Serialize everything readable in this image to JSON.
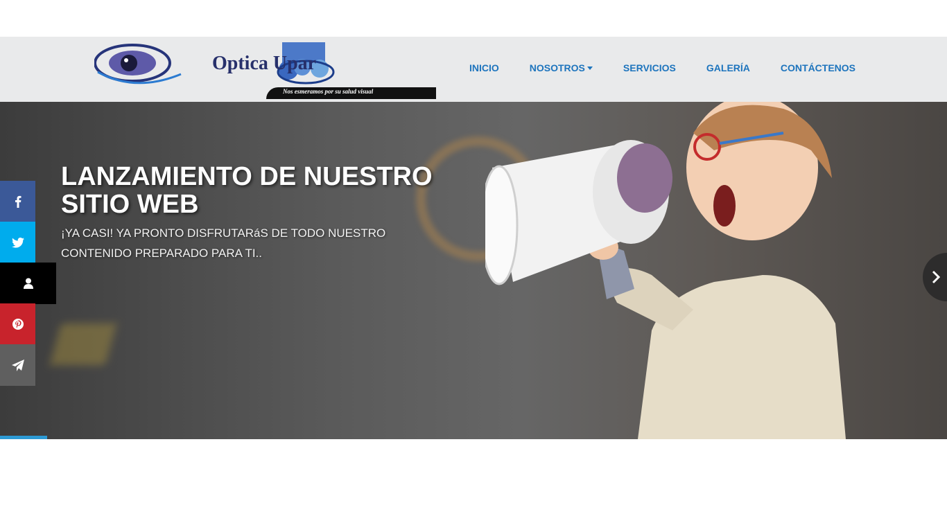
{
  "brand": {
    "name": "Optica Upar",
    "tagline": "Nos esmeramos por su salud visual"
  },
  "nav": {
    "items": [
      {
        "label": "INICIO"
      },
      {
        "label": "NOSOTROS"
      },
      {
        "label": "SERVICIOS"
      },
      {
        "label": "GALERÍA"
      },
      {
        "label": "CONTÁCTENOS"
      }
    ]
  },
  "hero": {
    "title": "LANZAMIENTO DE NUESTRO SITIO WEB",
    "subtitle": "¡YA CASI! YA PRONTO DISFRUTARáS DE TODO NUESTRO CONTENIDO PREPARADO PARA TI..",
    "slide_progress": 0.05
  },
  "social": {
    "items": [
      {
        "icon": "facebook-icon",
        "color": "#3b5998"
      },
      {
        "icon": "twitter-icon",
        "color": "#00aced"
      },
      {
        "icon": "user-icon",
        "color": "#000000"
      },
      {
        "icon": "pinterest-icon",
        "color": "#c8232c"
      },
      {
        "icon": "telegram-icon",
        "color": "#5f5f5f"
      }
    ]
  },
  "colors": {
    "nav_link": "#1d74bd",
    "navbar_bg": "#e9eaeb",
    "progress": "#2d9ad4"
  }
}
